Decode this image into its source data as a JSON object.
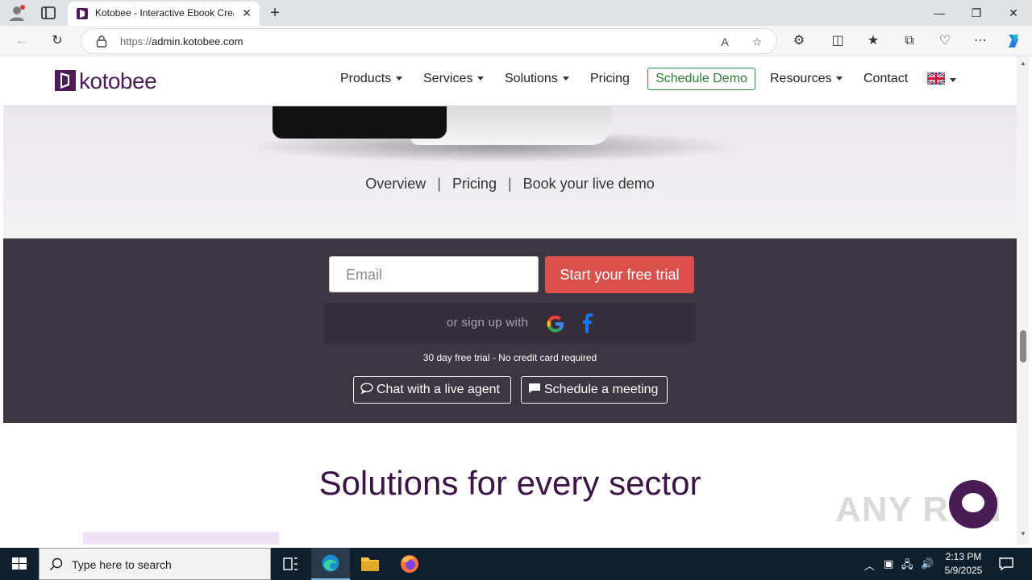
{
  "browser": {
    "tab_title": "Kotobee - Interactive Ebook Crea",
    "url_scheme": "https://",
    "url_host": "admin.kotobee.com"
  },
  "site": {
    "logo_text": "kotobee",
    "nav": {
      "products": "Products",
      "services": "Services",
      "solutions": "Solutions",
      "pricing": "Pricing",
      "schedule_demo": "Schedule Demo",
      "resources": "Resources",
      "contact": "Contact"
    },
    "hero_links": {
      "overview": "Overview",
      "sep1": "|",
      "pricing": "Pricing",
      "sep2": "|",
      "book_demo": "Book your live demo"
    },
    "trial": {
      "email_placeholder": "Email",
      "start_button": "Start your free trial",
      "signup_with": "or sign up with",
      "note": "30 day free trial - No credit card required",
      "chat_button": "Chat with a live agent",
      "meeting_button": "Schedule a meeting"
    },
    "solutions_title": "Solutions for every sector",
    "watermark": "ANY RUN"
  },
  "taskbar": {
    "search_placeholder": "Type here to search",
    "time": "2:13 PM",
    "date": "5/9/2025"
  },
  "colors": {
    "brand_purple": "#4c1a57",
    "cta_red": "#d9504c",
    "demo_green": "#2e8b3a",
    "band_dark": "#3d3541"
  }
}
